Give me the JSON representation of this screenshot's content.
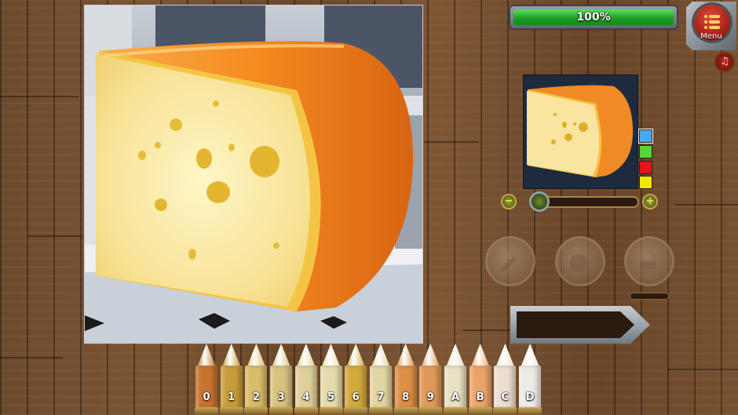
{
  "health": {
    "text": "100%",
    "percent": 100
  },
  "menu": {
    "label": "Menu"
  },
  "palette_swatches": [
    "#4aa8e8",
    "#56d63a",
    "#e0141b",
    "#f2e600"
  ],
  "zoom": {
    "minus": "−",
    "plus": "+",
    "level": 0.1
  },
  "crayons": [
    {
      "label": "0",
      "color": "#c8732e"
    },
    {
      "label": "1",
      "color": "#c99c3a"
    },
    {
      "label": "2",
      "color": "#d9bc6a"
    },
    {
      "label": "3",
      "color": "#d7c27f"
    },
    {
      "label": "4",
      "color": "#dfd09a"
    },
    {
      "label": "5",
      "color": "#e6dbac"
    },
    {
      "label": "6",
      "color": "#d2aa3a"
    },
    {
      "label": "7",
      "color": "#e2d5a3"
    },
    {
      "label": "8",
      "color": "#dd8f45"
    },
    {
      "label": "9",
      "color": "#e09a58"
    },
    {
      "label": "A",
      "color": "#e8e1c2"
    },
    {
      "label": "B",
      "color": "#eba468"
    },
    {
      "label": "C",
      "color": "#ecdfd2"
    },
    {
      "label": "D",
      "color": "#eeeae4"
    }
  ]
}
